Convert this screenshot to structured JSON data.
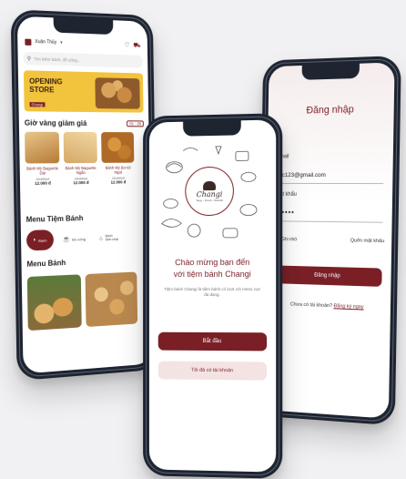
{
  "home": {
    "store_label": "Xuân Thủy",
    "search_placeholder": "Tìm kiếm bánh, đồ uống...",
    "banner_title": "OPENING",
    "banner_subtitle": "STORE",
    "banner_tag": "Changi",
    "deals_heading": "Giờ vàng giảm giá",
    "deals_timer": "01 : 28",
    "products": [
      {
        "name": "Bánh Mỳ Baguette Dài",
        "old_price": "15.000 đ",
        "price": "12.000 đ"
      },
      {
        "name": "Bánh Mỳ Baguette Ngắn",
        "old_price": "15.000 đ",
        "price": "12.000 đ"
      },
      {
        "name": "Bánh Mỳ Bơ tỏi Ngọt",
        "old_price": "15.000 đ",
        "price": "12.000 đ"
      }
    ],
    "menu_heading": "Menu Tiệm Bánh",
    "menu_items": [
      {
        "label": "Bánh"
      },
      {
        "label": "Đồ uống"
      },
      {
        "label": "Bánh Sinh nhật"
      }
    ],
    "menu_bread_heading": "Menu Bánh"
  },
  "welcome": {
    "logo_title": "Changi",
    "logo_tagline": "Tasty - Fresh - Natural",
    "heading_line1": "Chào mừng bạn đến",
    "heading_line2": "với tiệm bánh Changi",
    "description": "Tiệm bánh Changi là tiệm bánh có lượt với menu cực đa dạng.",
    "start_button": "Bắt đầu",
    "have_account_button": "Tôi đã có tài khoản"
  },
  "login": {
    "title": "Đăng nhập",
    "email_label": "Email",
    "email_value": "abc123@gmail.com",
    "password_label": "Mật khẩu",
    "password_value": "••••••",
    "remember_label": "Ghi nhớ",
    "forgot_link": "Quên mật khẩu",
    "login_button": "Đăng nhập",
    "no_account_text": "Chưa có tài khoản?",
    "register_link": "Đăng ký ngay"
  },
  "colors": {
    "brand": "#7a1f26",
    "banner": "#f2c33d",
    "light_button": "#f4e3e3"
  }
}
